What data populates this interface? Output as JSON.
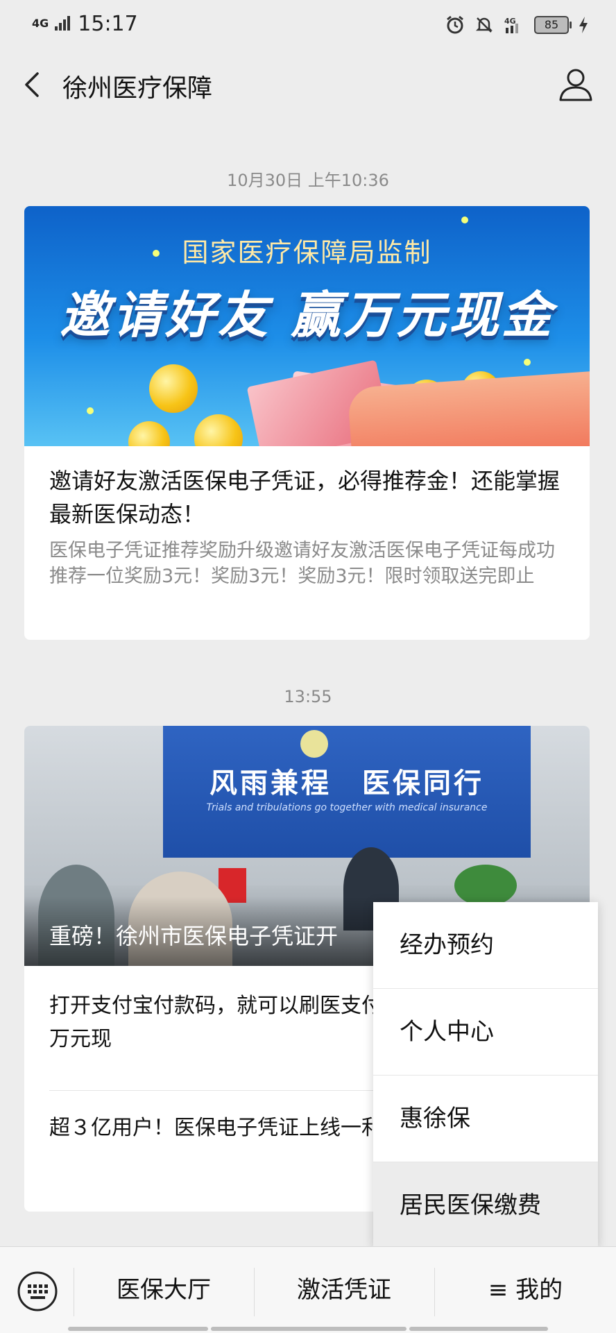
{
  "status_bar": {
    "network": "4G",
    "time": "15:17",
    "battery": "85"
  },
  "header": {
    "title": "徐州医疗保障"
  },
  "messages": [
    {
      "timestamp": "10月30日 上午10:36",
      "banner_subtitle": "国家医疗保障局监制",
      "banner_title": "邀请好友 赢万元现金",
      "title": "邀请好友激活医保电子凭证，必得推荐金！还能掌握最新医保动态！",
      "description": "医保电子凭证推荐奖励升级邀请好友激活医保电子凭证每成功推荐一位奖励3元！奖励3元！奖励3元！限时领取送完即止"
    },
    {
      "timestamp": "13:55",
      "banner_sign": "风雨兼程　医保同行",
      "banner_sign_en": "Trials and tribulations go together with medical insurance",
      "banner_title": "重磅！徐州市医保电子凭证开",
      "items": [
        "打开支付宝付款码，就可以刷医支付宝医保电子凭证，抽万元现",
        "超３亿用户！医保电子凭证上线一利重磅来袭！"
      ]
    }
  ],
  "popup_menu": {
    "items": [
      "经办预约",
      "个人中心",
      "惠徐保",
      "居民医保缴费"
    ],
    "highlighted": "居民医保缴费"
  },
  "bottom_menu": {
    "tabs": [
      "医保大厅",
      "激活凭证",
      "≡ 我的"
    ]
  }
}
